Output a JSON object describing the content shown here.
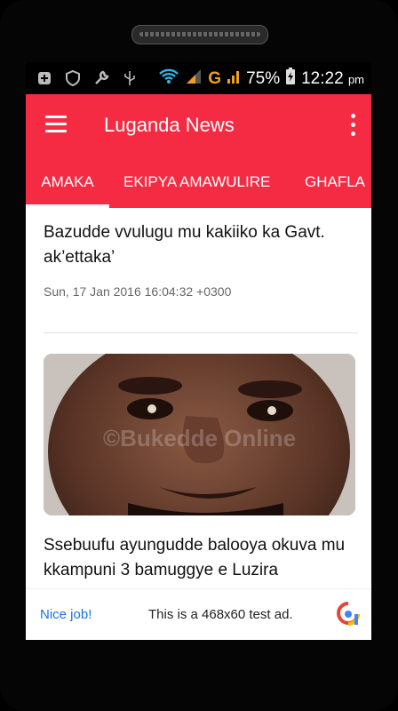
{
  "status": {
    "icons_left": [
      "notification-plus-icon",
      "shield-icon",
      "wrench-icon",
      "usb-icon"
    ],
    "icons_right": [
      "wifi-icon",
      "signal-icon",
      "battery-charging-icon"
    ],
    "network": "G",
    "battery": "75%",
    "time": "12:22",
    "ampm": "pm"
  },
  "appbar": {
    "title": "Luganda News"
  },
  "tabs": [
    {
      "label": "AMAKA",
      "active": true
    },
    {
      "label": "EKIPYA AMAWULIRE",
      "active": false
    },
    {
      "label": "GHAFLA",
      "active": false
    }
  ],
  "articles": [
    {
      "title": "Bazudde vvulugu mu kakiiko ka Gavt. ak’ettaka’",
      "date": "Sun, 17 Jan 2016 16:04:32 +0300"
    },
    {
      "title": "Ssebuufu ayungudde balooya okuva mu kkampuni 3 bamuggye e Luzira",
      "image_watermark": "©Bukedde Online"
    }
  ],
  "ad": {
    "nice": "Nice job!",
    "text": "This is a 468x60 test ad."
  },
  "colors": {
    "accent": "#f42b42",
    "link": "#1a73e8"
  }
}
